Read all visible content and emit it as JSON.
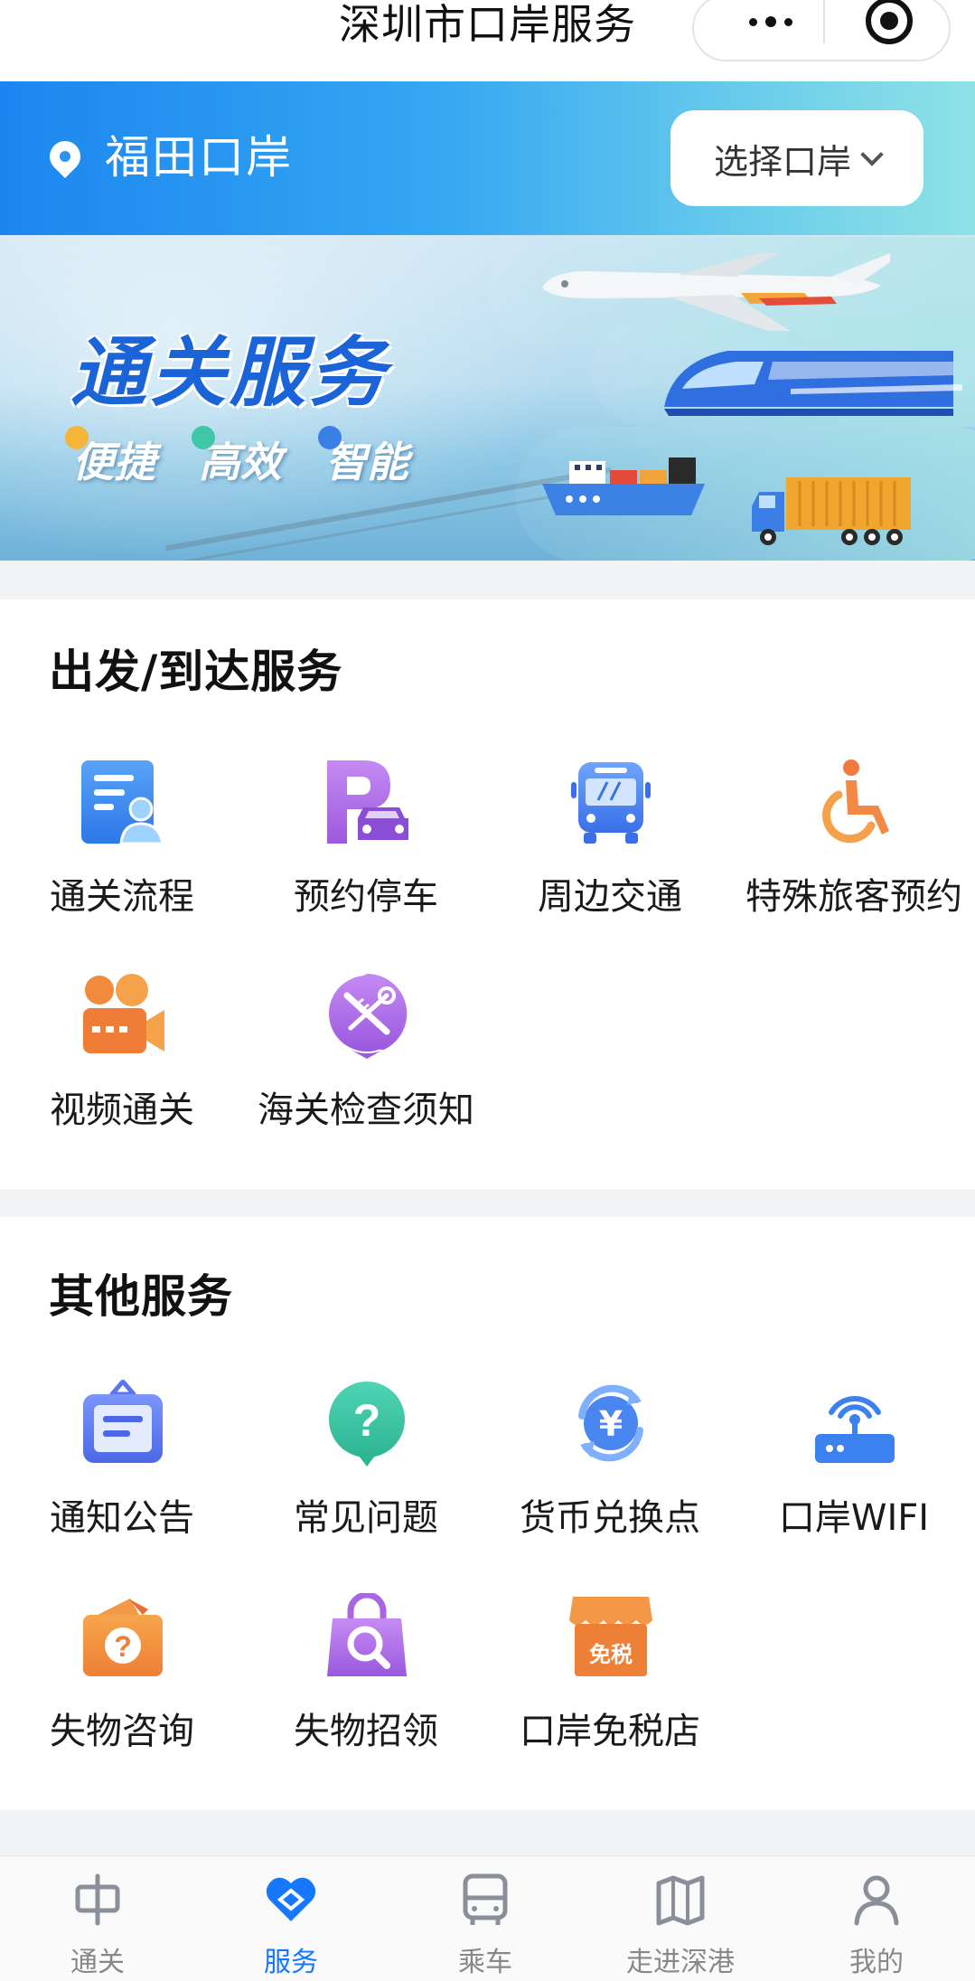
{
  "title_bar": {
    "title": "深圳市口岸服务",
    "more_icon": "more-dots-icon",
    "close_icon": "target-circle-icon"
  },
  "location": {
    "current": "福田口岸",
    "select_label": "选择口岸"
  },
  "banner": {
    "title": "通关服务",
    "tags": [
      "便捷",
      "高效",
      "智能"
    ]
  },
  "sections": [
    {
      "title": "出发/到达服务",
      "items": [
        {
          "label": "通关流程",
          "icon": "document-person-icon"
        },
        {
          "label": "预约停车",
          "icon": "parking-car-icon"
        },
        {
          "label": "周边交通",
          "icon": "bus-icon"
        },
        {
          "label": "特殊旅客预约",
          "icon": "wheelchair-icon"
        },
        {
          "label": "视频通关",
          "icon": "video-camera-icon"
        },
        {
          "label": "海关检查须知",
          "icon": "inspection-tools-icon"
        }
      ]
    },
    {
      "title": "其他服务",
      "items": [
        {
          "label": "通知公告",
          "icon": "notice-board-icon"
        },
        {
          "label": "常见问题",
          "icon": "question-bubble-icon"
        },
        {
          "label": "货币兑换点",
          "icon": "currency-exchange-icon"
        },
        {
          "label": "口岸WIFI",
          "icon": "wifi-router-icon"
        },
        {
          "label": "失物咨询",
          "icon": "lost-item-box-icon"
        },
        {
          "label": "失物招领",
          "icon": "search-bag-icon"
        },
        {
          "label": "口岸免税店",
          "icon": "duty-free-shop-icon",
          "badge": "免税"
        }
      ]
    }
  ],
  "tabbar": {
    "active": "服务",
    "tabs": [
      {
        "label": "通关",
        "icon": "customs-icon"
      },
      {
        "label": "服务",
        "icon": "service-icon"
      },
      {
        "label": "乘车",
        "icon": "bus-front-icon"
      },
      {
        "label": "走进深港",
        "icon": "map-icon"
      },
      {
        "label": "我的",
        "icon": "user-icon"
      }
    ]
  },
  "colors": {
    "accent": "#1677ff",
    "header_gradient_start": "#1c86f0",
    "header_gradient_end": "#8fe2e6",
    "banner_title": "#1a64d8"
  }
}
